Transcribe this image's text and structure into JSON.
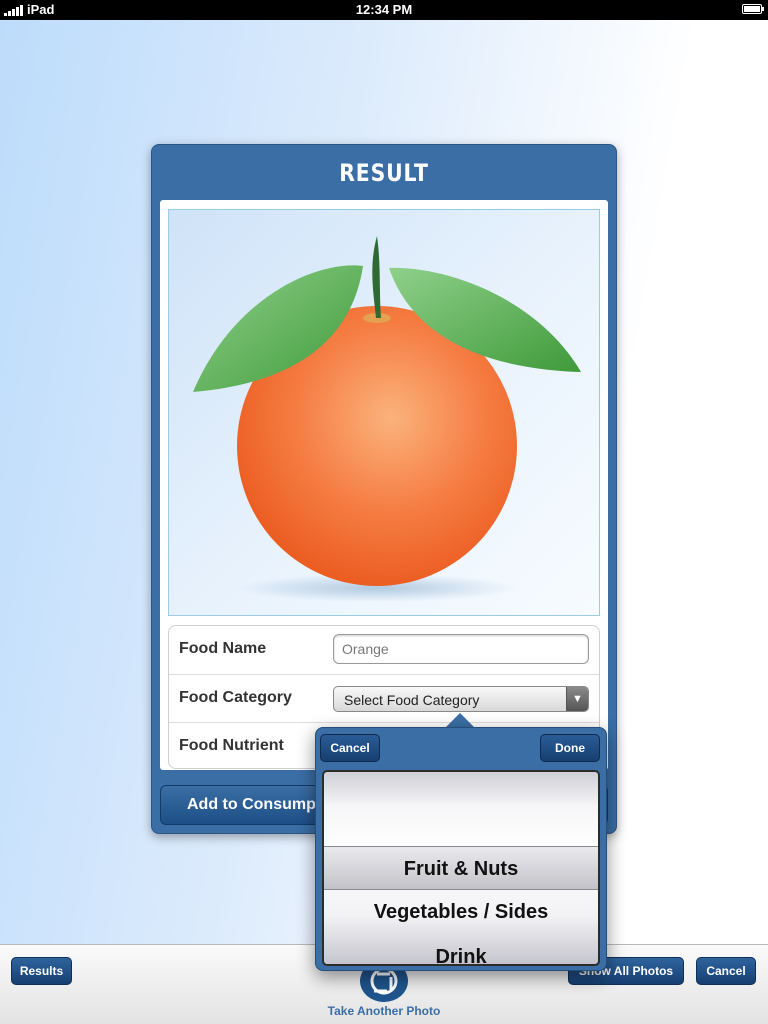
{
  "status_bar": {
    "carrier": "iPad",
    "time": "12:34 PM"
  },
  "card": {
    "title": "RESULT",
    "form": {
      "food_name": {
        "label": "Food Name",
        "value": "Orange"
      },
      "food_category": {
        "label": "Food Category",
        "selected": "Select Food Category"
      },
      "food_nutrient": {
        "label": "Food Nutrient"
      }
    },
    "add_button": "Add to Consump"
  },
  "picker_popover": {
    "cancel": "Cancel",
    "done": "Done",
    "options": [
      "",
      "Fruit & Nuts",
      "Vegetables / Sides",
      "Drink"
    ],
    "selected_index": 1
  },
  "toolbar": {
    "results": "Results",
    "take_photo": "Take Another Photo",
    "show_all_photos": "Show All Photos",
    "cancel": "Cancel"
  },
  "colors": {
    "accent": "#3a6ea5",
    "button": "#1e4f87"
  }
}
